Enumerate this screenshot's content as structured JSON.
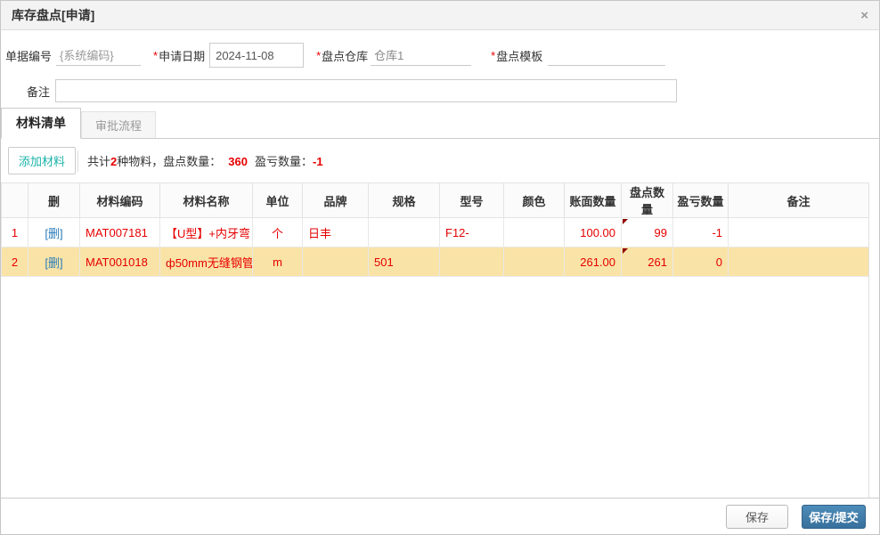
{
  "dialog": {
    "title": "库存盘点[申请]",
    "close_icon": "×"
  },
  "form": {
    "fields": [
      {
        "label": "单据编号",
        "required": "",
        "value": "{系统编码}"
      },
      {
        "label": "申请日期",
        "required": "*",
        "value": "2024-11-08"
      },
      {
        "label": "盘点仓库",
        "required": "*",
        "value": "仓库1"
      },
      {
        "label": "盘点模板",
        "required": "*",
        "value": ""
      }
    ],
    "remark": {
      "label": "备注",
      "value": ""
    }
  },
  "tabs": [
    {
      "label": "材料清单"
    },
    {
      "label": "审批流程"
    }
  ],
  "toolbar": {
    "add_button": "添加材料",
    "summary": {
      "prefix": "共计",
      "count": "2",
      "mid1": "种物料，盘点数量：",
      "qty": "360",
      "mid2": "盈亏数量：",
      "diff": "-1"
    }
  },
  "table": {
    "columns": [
      "",
      "删",
      "材料编码",
      "材料名称",
      "单位",
      "品牌",
      "规格",
      "型号",
      "颜色",
      "账面数量",
      "盘点数量",
      "盈亏数量",
      "备注"
    ],
    "rows": [
      {
        "index": "1",
        "del": "[删]",
        "code": "MAT007181",
        "name": "【U型】+内牙弯",
        "unit": "个",
        "brand": "日丰",
        "spec": "",
        "model": "F12-",
        "color": "",
        "book_qty": "100.00",
        "check_qty": "99",
        "diff_qty": "-1",
        "remark": ""
      },
      {
        "index": "2",
        "del": "[删]",
        "code": "MAT001018",
        "name": "ф50mm无缝钢管",
        "unit": "m",
        "brand": "",
        "spec": "501",
        "model": "",
        "color": "",
        "book_qty": "261.00",
        "check_qty": "261",
        "diff_qty": "0",
        "remark": ""
      }
    ]
  },
  "footer": {
    "save_label": "保存",
    "submit_label": "保存/提交"
  },
  "colors": {
    "accent_blue": "#3d7ba8",
    "teal": "#1ab3a8",
    "red": "#e60000",
    "link_blue": "#2b7dbc",
    "highlight_row": "#f9e3a6"
  }
}
